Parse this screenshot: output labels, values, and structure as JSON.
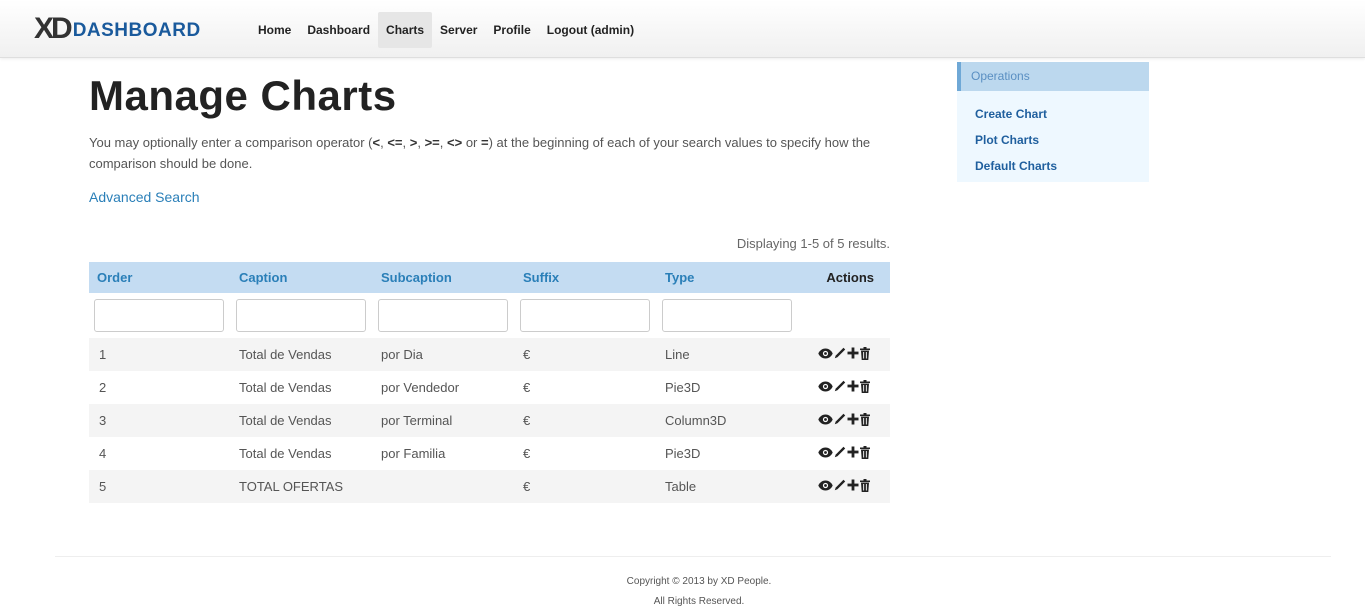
{
  "brand": {
    "logo_letters": "XD",
    "text": "DASHBOARD",
    "color": "#1a5a9c"
  },
  "nav": {
    "items": [
      {
        "label": "Home",
        "active": false
      },
      {
        "label": "Dashboard",
        "active": false
      },
      {
        "label": "Charts",
        "active": true
      },
      {
        "label": "Server",
        "active": false
      },
      {
        "label": "Profile",
        "active": false
      },
      {
        "label": "Logout (admin)",
        "active": false
      }
    ]
  },
  "page": {
    "title": "Manage Charts",
    "intro_prefix": "You may optionally enter a comparison operator (",
    "operators": [
      "<",
      "<=",
      ">",
      ">=",
      "<>",
      "="
    ],
    "intro_suffix": ") at the beginning of each of your search values to specify how the comparison should be done.",
    "advanced_search_label": "Advanced Search",
    "summary": "Displaying 1-5 of 5 results."
  },
  "table": {
    "columns": [
      "Order",
      "Caption",
      "Subcaption",
      "Suffix",
      "Type",
      "Actions"
    ],
    "rows": [
      {
        "order": "1",
        "caption": "Total de Vendas",
        "subcaption": "por Dia",
        "suffix": "€",
        "type": "Line"
      },
      {
        "order": "2",
        "caption": "Total de Vendas",
        "subcaption": "por Vendedor",
        "suffix": "€",
        "type": "Pie3D"
      },
      {
        "order": "3",
        "caption": "Total de Vendas",
        "subcaption": "por Terminal",
        "suffix": "€",
        "type": "Column3D"
      },
      {
        "order": "4",
        "caption": "Total de Vendas",
        "subcaption": "por Familia",
        "suffix": "€",
        "type": "Pie3D"
      },
      {
        "order": "5",
        "caption": "TOTAL OFERTAS",
        "subcaption": "",
        "suffix": "€",
        "type": "Table"
      }
    ],
    "action_icons": [
      "eye-icon",
      "pencil-icon",
      "plus-icon",
      "trash-icon"
    ],
    "header_bg": "#c4dcf2",
    "header_color": "#2a7fb8"
  },
  "sidebar": {
    "header": "Operations",
    "links": [
      "Create Chart",
      "Plot Charts",
      "Default Charts"
    ]
  },
  "footer": {
    "copyright": "Copyright © 2013 by XD People.",
    "rights": "All Rights Reserved."
  }
}
